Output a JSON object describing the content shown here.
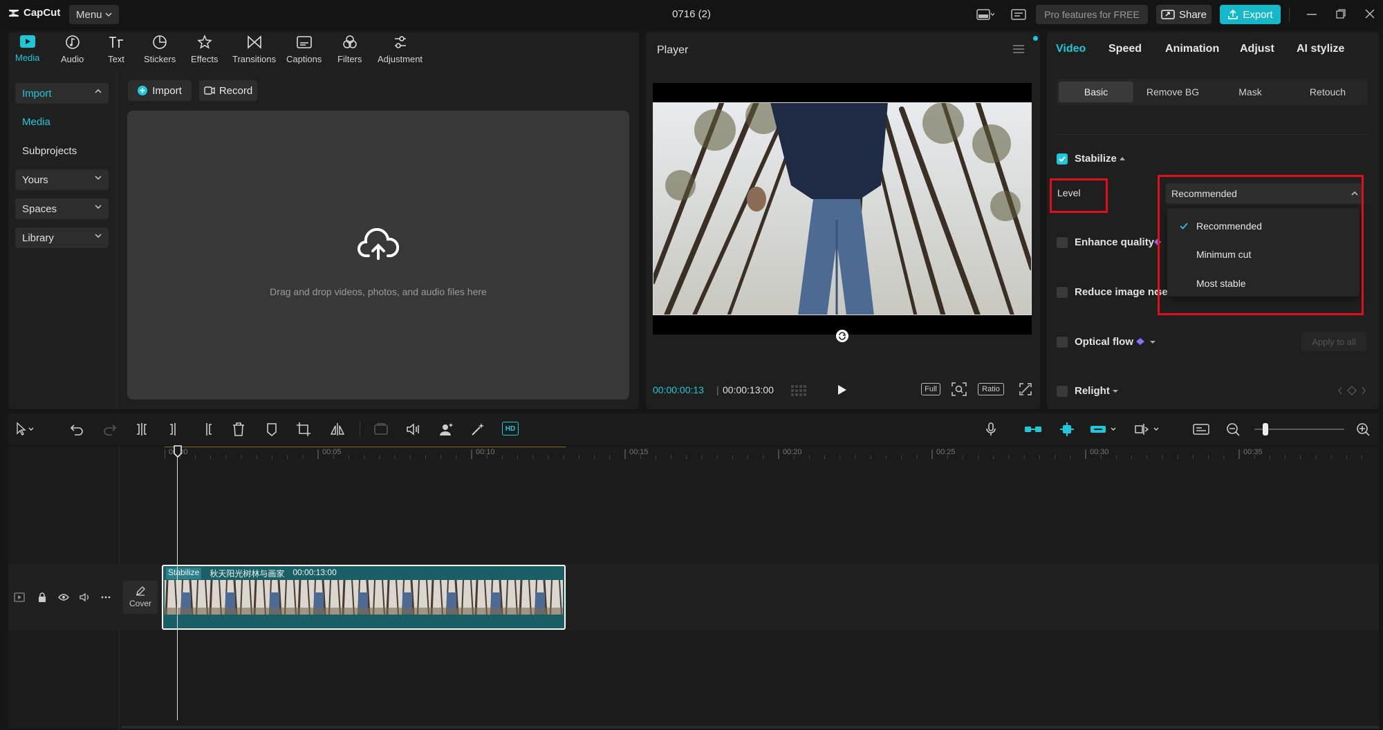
{
  "app": {
    "name": "CapCut",
    "menu_label": "Menu",
    "project_title": "0716 (2)"
  },
  "titlebar": {
    "pro_label": "Pro features for FREE",
    "share_label": "Share",
    "export_label": "Export"
  },
  "toolbar": {
    "tabs": [
      {
        "label": "Media",
        "icon": "media-icon",
        "active": true
      },
      {
        "label": "Audio",
        "icon": "audio-icon"
      },
      {
        "label": "Text",
        "icon": "text-icon"
      },
      {
        "label": "Stickers",
        "icon": "stickers-icon"
      },
      {
        "label": "Effects",
        "icon": "effects-icon"
      },
      {
        "label": "Transitions",
        "icon": "transitions-icon"
      },
      {
        "label": "Captions",
        "icon": "captions-icon"
      },
      {
        "label": "Filters",
        "icon": "filters-icon"
      },
      {
        "label": "Adjustment",
        "icon": "adjustment-icon"
      }
    ]
  },
  "sidebar": {
    "items": [
      {
        "label": "Import"
      },
      {
        "label": "Media"
      },
      {
        "label": "Subprojects"
      },
      {
        "label": "Yours"
      },
      {
        "label": "Spaces"
      },
      {
        "label": "Library"
      }
    ]
  },
  "media": {
    "import_button": "Import",
    "record_button": "Record",
    "drop_text": "Drag and drop videos, photos, and audio files here"
  },
  "player": {
    "title": "Player",
    "current_time": "00:00:00:13",
    "total_time": "00:00:13:00",
    "full_label": "Full",
    "ratio_label": "Ratio"
  },
  "inspector": {
    "tabs": [
      "Video",
      "Speed",
      "Animation",
      "Adjust",
      "AI stylize"
    ],
    "subtabs": [
      "Basic",
      "Remove BG",
      "Mask",
      "Retouch"
    ],
    "stabilize_label": "Stabilize",
    "level_label": "Level",
    "level_value": "Recommended",
    "level_options": [
      "Recommended",
      "Minimum cut",
      "Most stable"
    ],
    "enhance_quality_label": "Enhance quality",
    "reduce_noise_label": "Reduce image no",
    "reduce_noise_suffix": "se",
    "optical_flow_label": "Optical flow",
    "apply_all_label": "Apply to all",
    "relight_label": "Relight"
  },
  "timeline": {
    "hd_label": "HD",
    "ruler": [
      "00:00",
      "00:05",
      "00:10",
      "00:15",
      "00:20",
      "00:25",
      "00:30",
      "00:35"
    ],
    "cover_label": "Cover",
    "clip": {
      "tag": "Stabilize",
      "name": "秋天阳光树林与画家",
      "duration": "00:00:13:00"
    }
  },
  "colors": {
    "accent": "#1ec8d8",
    "highlight": "#e0101a",
    "panel": "#1f1f1f"
  }
}
